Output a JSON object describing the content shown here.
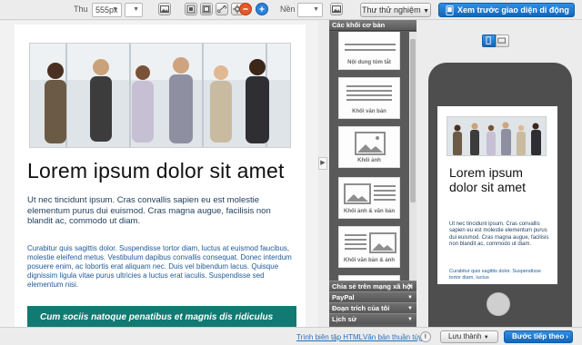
{
  "toolbar": {
    "width_label": "Thu",
    "width_value": "555px",
    "bg_label": "Nền",
    "test_button": "Thư thử nghiệm",
    "preview_button": "Xem trước giao diện di động"
  },
  "email": {
    "heading": "Lorem ipsum dolor sit amet",
    "intro": "Ut nec tincidunt ipsum. Cras convallis sapien eu est molestie elementum purus dui euismod. Cras magna augue, facilisis non blandit ac, commodo ut diam.",
    "body": "Curabitur quis sagittis dolor. Suspendisse tortor diam, luctus at euismod faucibus, molestie eleifend metus. Vestibulum dapibus convallis consequat. Donec interdum posuere enim, ac lobortis erat aliquam nec. Duis vel bibendum lacus. Quisque dignissim ligula vitae purus ultricies a luctus erat iaculis. Suspendisse sed elementum nisi.",
    "quote": "Cum sociis natoque penatibus et magnis dis ridiculus"
  },
  "panel": {
    "header": "Các khối cơ bản",
    "blocks": [
      "Nội dung tóm tắt",
      "Khối văn bản",
      "Khối ảnh",
      "Khối ảnh & văn bản",
      "Khối văn bản & ảnh"
    ],
    "sections": [
      "Chia sẻ trên mạng xã hội",
      "PayPal",
      "Đoạn trích của tôi",
      "Lịch sử"
    ]
  },
  "phone": {
    "heading": "Lorem ipsum dolor sit amet",
    "intro": "Ut nec tincidunt ipsum. Cras convallis sapien eu est molestie elementum purus dui euismod. Cras magna augue, facilisis non blandit ac, commodo ut diam.",
    "body": "Curabitur quis sagittis dolor. Suspendisse tortor diam, luctus"
  },
  "bottom": {
    "html_link": "Trình biên tập HTML",
    "text_link": "Văn bản thuần túy",
    "save_button": "Lưu thành",
    "next_button": "Bước tiếp theo"
  }
}
